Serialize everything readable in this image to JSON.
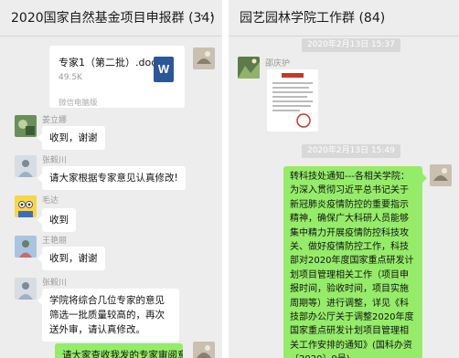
{
  "left": {
    "title": "2020国家自然基金项目申报群 (34)",
    "more_glyph": "···",
    "file": {
      "name": "专家1（第二批）.doc",
      "size": "49.5K",
      "source": "微信电脑版",
      "icon": "W"
    },
    "messages": [
      {
        "sender": "姜立娜",
        "text": "收到，谢谢"
      },
      {
        "sender": "张毅川",
        "text": "请大家根据专家意见认真修改!"
      },
      {
        "sender": "毛达",
        "text": "收到"
      },
      {
        "sender": "王艳丽",
        "text": "收到，谢谢"
      },
      {
        "sender": "张毅川",
        "text": "学院将综合几位专家的意见筛选一批质量较高的，再次送外审，请认真修改。"
      }
    ],
    "outgoing": {
      "text": "请大家查收我发的专家审阅意"
    }
  },
  "right": {
    "title": "园艺园林学院工作群 (84)",
    "time1": "2020年2月13日 15:37",
    "sender1": "邵庆护",
    "time2": "2020年2月13日 15:49",
    "outgoing": {
      "text": "转科技处通知---各相关学院：为深入贯彻习近平总书记关于新冠肺炎疫情防控的重要指示精神，确保广大科研人员能够集中精力开展疫情防控科技攻关、做好疫情防控工作，科技部对2020年度国家重点研发计划项目管理相关工作（项目申报时间，验收时间，项目实施周期等）进行调整，详见《科技部办公厅关于调整2020年度国家重点研发计划项目管理相关工作安排的通知》(国科办资〔2020〕9号)。"
    }
  },
  "colors": {
    "pane_bg": "#ededed",
    "outgoing_bubble": "#95ec69",
    "incoming_bubble": "#ffffff",
    "word_blue": "#2b579a"
  }
}
